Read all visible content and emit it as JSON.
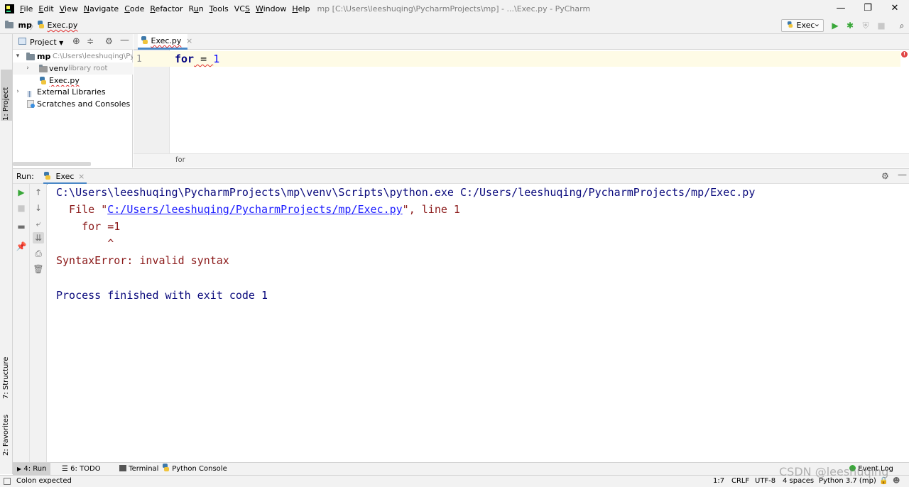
{
  "menu": {
    "items": [
      "File",
      "Edit",
      "View",
      "Navigate",
      "Code",
      "Refactor",
      "Run",
      "Tools",
      "VCS",
      "Window",
      "Help"
    ],
    "underline_chars": [
      "F",
      "E",
      "V",
      "N",
      "C",
      "R",
      "u",
      "T",
      "S",
      "W",
      "H"
    ]
  },
  "window": {
    "title": "mp [C:\\Users\\leeshuqing\\PycharmProjects\\mp] - ...\\Exec.py - PyCharm",
    "minimize": "—",
    "restore": "❐",
    "close": "✕"
  },
  "navbar": {
    "project": "mp",
    "separator": "〉",
    "file": "Exec.py",
    "run_config": "Exec",
    "run_config_arrow": "⌄"
  },
  "left_strip": {
    "project_tab": "1: Project",
    "structure_tab": "7: Structure",
    "favorites_tab": "2: Favorites"
  },
  "project_panel": {
    "view_label": "Project",
    "tree": [
      {
        "label": "mp",
        "hint": "C:\\Users\\leeshuqing\\Py"
      },
      {
        "label": "venv",
        "hint": "library root"
      },
      {
        "label": "Exec.py",
        "hint": ""
      },
      {
        "label": "External Libraries",
        "hint": ""
      },
      {
        "label": "Scratches and Consoles",
        "hint": ""
      }
    ]
  },
  "editor": {
    "tab_label": "Exec.py",
    "tab_close": "×",
    "line_number": "1",
    "code": {
      "keyword": "for",
      "operator": " = ",
      "number": "1"
    },
    "breadcrumb": "for",
    "error_marker": "!"
  },
  "run_panel": {
    "title": "Run:",
    "tab_label": "Exec",
    "tab_close": "×",
    "console": [
      "C:\\Users\\leeshuqing\\PycharmProjects\\mp\\venv\\Scripts\\python.exe C:/Users/leeshuqing/PycharmProjects/mp/Exec.py",
      "  File \"",
      "C:/Users/leeshuqing/PycharmProjects/mp/Exec.py",
      "\", line 1",
      "    for =1",
      "        ^",
      "SyntaxError: invalid syntax",
      "Process finished with exit code 1"
    ]
  },
  "bottom_tabs": {
    "run": "4: Run",
    "todo": "6: TODO",
    "terminal": "Terminal",
    "python_console": "Python Console",
    "event_log": "Event Log"
  },
  "statusbar": {
    "message": "Colon expected",
    "position": "1:7",
    "line_sep": "CRLF",
    "encoding": "UTF-8",
    "indent": "4 spaces",
    "interpreter": "Python 3.7 (mp)"
  },
  "watermark": "CSDN @leeshuqing",
  "colors": {
    "keyword": "#000080",
    "number": "#0000ff",
    "console_path": "#0a0a7d",
    "error_text": "#8b1a1a",
    "link": "#1a1aff",
    "run_green": "#3aa83a",
    "tab_accent": "#4a88c7"
  }
}
